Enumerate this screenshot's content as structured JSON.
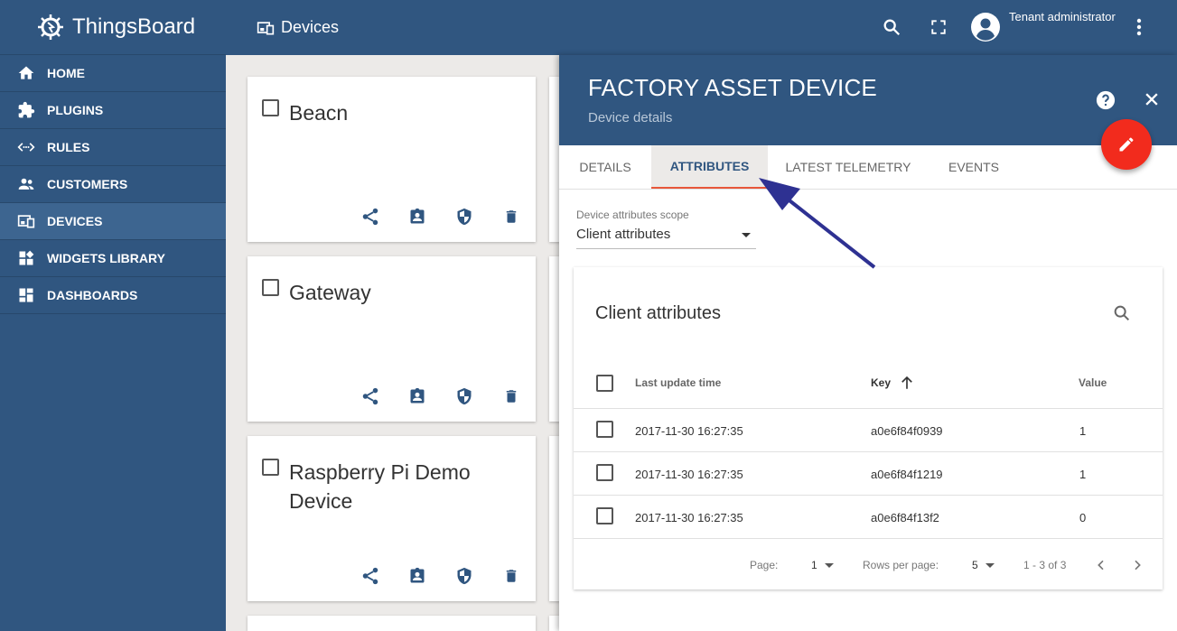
{
  "app": {
    "name": "ThingsBoard"
  },
  "sidebar": {
    "items": [
      {
        "label": "HOME",
        "icon": "home-icon"
      },
      {
        "label": "PLUGINS",
        "icon": "puzzle-icon"
      },
      {
        "label": "RULES",
        "icon": "code-arrows-icon"
      },
      {
        "label": "CUSTOMERS",
        "icon": "people-icon"
      },
      {
        "label": "DEVICES",
        "icon": "devices-icon",
        "active": true
      },
      {
        "label": "WIDGETS LIBRARY",
        "icon": "widgets-icon"
      },
      {
        "label": "DASHBOARDS",
        "icon": "dashboard-icon"
      }
    ]
  },
  "topbar": {
    "title": "Devices",
    "user": "Tenant administrator"
  },
  "devices": [
    {
      "name": "Beacn"
    },
    {
      "name": "Gateway"
    },
    {
      "name": "Raspberry Pi Demo Device"
    }
  ],
  "details": {
    "title": "FACTORY ASSET DEVICE",
    "subtitle": "Device details",
    "tabs": [
      "DETAILS",
      "ATTRIBUTES",
      "LATEST TELEMETRY",
      "EVENTS"
    ],
    "active_tab": "ATTRIBUTES",
    "scope_label": "Device attributes scope",
    "scope_value": "Client attributes",
    "table": {
      "title": "Client attributes",
      "columns": [
        "Last update time",
        "Key",
        "Value"
      ],
      "rows": [
        {
          "time": "2017-11-30 16:27:35",
          "key": "a0e6f84f0939",
          "value": "1"
        },
        {
          "time": "2017-11-30 16:27:35",
          "key": "a0e6f84f1219",
          "value": "1"
        },
        {
          "time": "2017-11-30 16:27:35",
          "key": "a0e6f84f13f2",
          "value": "0"
        }
      ],
      "page_label": "Page:",
      "page": "1",
      "rows_per_page_label": "Rows per page:",
      "rows_per_page": "5",
      "range": "1 - 3 of 3"
    }
  },
  "colors": {
    "primary": "#305680",
    "accent": "#f22b1d",
    "arrow": "#2e3192"
  }
}
